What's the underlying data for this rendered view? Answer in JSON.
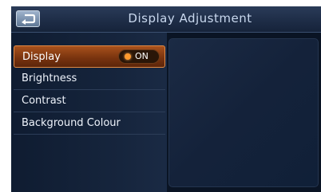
{
  "header": {
    "title": "Display Adjustment"
  },
  "menu": {
    "items": [
      {
        "label": "Display",
        "toggle": "ON"
      },
      {
        "label": "Brightness"
      },
      {
        "label": "Contrast"
      },
      {
        "label": "Background Colour"
      }
    ]
  },
  "colors": {
    "accent": "#a9521c",
    "indicator": "#ff9a2e",
    "background": "#0a1424"
  },
  "icons": {
    "back": "back-arrow-icon",
    "toggle_indicator": "dot-icon"
  }
}
